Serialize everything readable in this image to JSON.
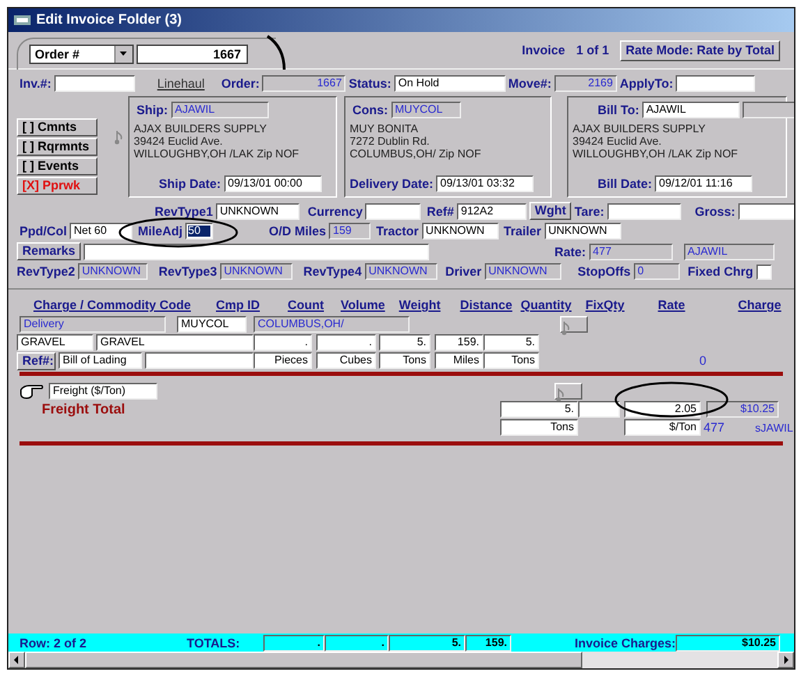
{
  "window": {
    "title": "Edit Invoice Folder (3)"
  },
  "lookup": {
    "field": "Order #",
    "value": "1667"
  },
  "invoice": {
    "label": "Invoice",
    "count": "1 of 1"
  },
  "rate_mode_button": "Rate Mode: Rate by Total",
  "inv_no": {
    "label": "Inv.#:"
  },
  "linehaul_link": "Linehaul",
  "order": {
    "label": "Order:",
    "value": "1667"
  },
  "status": {
    "label": "Status:",
    "value": "On Hold"
  },
  "move": {
    "label": "Move#:",
    "value": "2169"
  },
  "apply_to": {
    "label": "ApplyTo:"
  },
  "side_buttons": [
    {
      "label": "[ ] Cmnts",
      "flagged": false
    },
    {
      "label": "[ ] Rqrmnts",
      "flagged": false
    },
    {
      "label": "[ ] Events",
      "flagged": false
    },
    {
      "label": "[X] Pprwk",
      "flagged": true
    }
  ],
  "stops": [
    {
      "label": "Ship:",
      "code": "AJAWIL",
      "lines": [
        "AJAX BUILDERS SUPPLY",
        "39424 Euclid Ave.",
        "WILLOUGHBY,OH    /LAK Zip NOF"
      ],
      "date_label": "Ship Date:",
      "date": "09/13/01 00:00"
    },
    {
      "label": "Cons:",
      "code": "MUYCOL",
      "lines": [
        "MUY BONITA",
        "7272 Dublin Rd.",
        "COLUMBUS,OH/ Zip NOF"
      ],
      "date_label": "Delivery Date:",
      "date": "09/13/01 03:32"
    },
    {
      "label": "Bill To:",
      "code": "AJAWIL",
      "lines": [
        "AJAX BUILDERS SUPPLY",
        "39424 Euclid Ave.",
        "WILLOUGHBY,OH    /LAK Zip NOF"
      ],
      "date_label": "Bill Date:",
      "date": "09/12/01 11:16"
    }
  ],
  "detail_rows": [
    {
      "items": [
        {
          "label": "RevType1",
          "value": "UNKNOWN",
          "kind": "input"
        },
        {
          "label": "Currency",
          "kind": "input"
        },
        {
          "label": "Ref#",
          "value": "912A2",
          "kind": "input"
        },
        {
          "label": "Wght",
          "kind": "button"
        },
        {
          "label": "Tare:",
          "kind": "input"
        },
        {
          "label": "Gross:",
          "kind": "input"
        }
      ]
    },
    {
      "items": [
        {
          "label": "Ppd/Col",
          "value": "Net 60",
          "kind": "input"
        },
        {
          "label": "MileAdj",
          "value": "50",
          "kind": "input",
          "text_selected": true
        },
        {
          "label": "O/D Miles",
          "value": "159",
          "kind": "readonly"
        },
        {
          "label": "Tractor",
          "value": "UNKNOWN",
          "kind": "input"
        },
        {
          "label": "Trailer",
          "value": "UNKNOWN",
          "kind": "input"
        }
      ]
    },
    {
      "items": [
        {
          "label": "Remarks",
          "kind": "button"
        },
        {
          "kind": "input"
        },
        {
          "label": "Rate:",
          "value": "477",
          "kind": "readonly"
        },
        {
          "value": "AJAWIL",
          "kind": "readonly"
        }
      ]
    },
    {
      "items": [
        {
          "label": "RevType2",
          "value": "UNKNOWN",
          "kind": "readonly"
        },
        {
          "label": "RevType3",
          "value": "UNKNOWN",
          "kind": "readonly"
        },
        {
          "label": "RevType4",
          "value": "UNKNOWN",
          "kind": "readonly"
        },
        {
          "label": "Driver",
          "value": "UNKNOWN",
          "kind": "readonly"
        },
        {
          "label": "StopOffs",
          "value": "0",
          "kind": "readonly"
        },
        {
          "label": "Fixed Chrg",
          "kind": "checkbox",
          "checked": false
        }
      ]
    }
  ],
  "columns": [
    "Charge / Commodity Code",
    "Cmp ID",
    "Count",
    "Volume",
    "Weight",
    "Distance",
    "Quantity",
    "FixQty",
    "Rate",
    "Charge"
  ],
  "line_rows": [
    {
      "cells": [
        {
          "value": "Delivery",
          "kind": "readonly"
        },
        {
          "value": "MUYCOL",
          "kind": "input"
        },
        {
          "value": "COLUMBUS,OH/",
          "kind": "readonly"
        },
        {
          "kind": "toggle"
        }
      ]
    },
    {
      "cells": [
        {
          "value": "GRAVEL",
          "kind": "input"
        },
        {
          "value": "GRAVEL",
          "kind": "input"
        },
        {
          "value": ".",
          "kind": "number"
        },
        {
          "value": ".",
          "kind": "number"
        },
        {
          "value": "5.",
          "kind": "number"
        },
        {
          "value": "159.",
          "kind": "number"
        },
        {
          "value": "5.",
          "kind": "number"
        }
      ]
    },
    {
      "cells": [
        {
          "value": "Ref#:",
          "kind": "button"
        },
        {
          "value": "Bill of Lading",
          "kind": "input"
        },
        {
          "kind": "input"
        },
        {
          "value": "Pieces",
          "kind": "number"
        },
        {
          "value": "Cubes",
          "kind": "number"
        },
        {
          "value": "Tons",
          "kind": "number"
        },
        {
          "value": "Miles",
          "kind": "number"
        },
        {
          "value": "Tons",
          "kind": "number"
        },
        {
          "value": "0",
          "kind": "plain"
        }
      ]
    }
  ],
  "freight": {
    "description": "Freight ($/Ton)",
    "total_label": "Freight Total",
    "quantity": "5.",
    "rate": "2.05",
    "charge": "$10.25",
    "quantity_unit": "Tons",
    "rate_unit": "$/Ton",
    "rate_number": "477",
    "rate_code": "sJAWIL"
  },
  "footer": {
    "row": "Row:  2 of 2",
    "totals_label": "TOTALS:",
    "totals": [
      ".",
      ".",
      "5.",
      "159."
    ],
    "invoice_charges_label": "Invoice Charges:",
    "invoice_charges": "$10.25"
  }
}
